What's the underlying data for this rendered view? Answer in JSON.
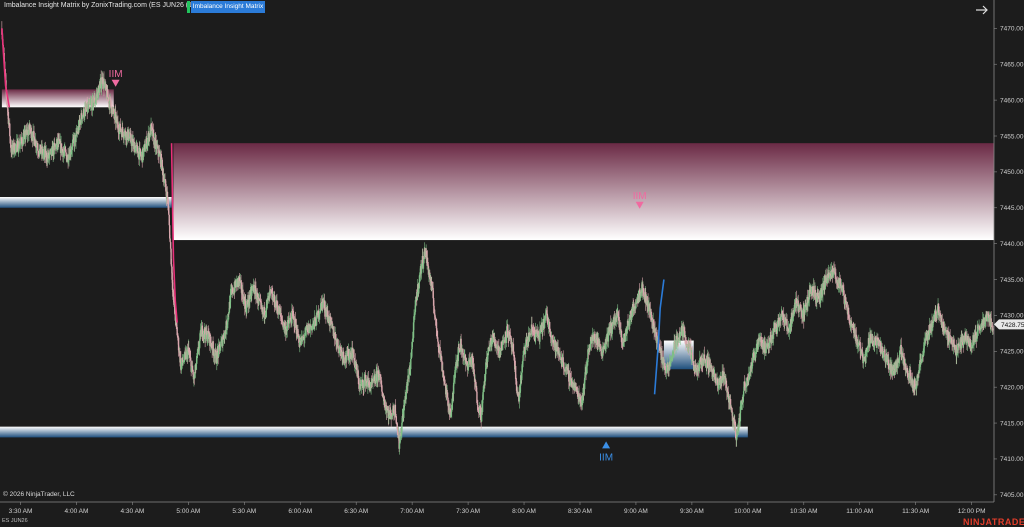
{
  "header": {
    "title": "Imbalance Insight Matrix by ZonixTrading.com (ES JUN26 (1 Minute))",
    "indicator_tab": "Imbalance Insight Matrix"
  },
  "footer": {
    "copyright": "© 2026 NinjaTrader, LLC",
    "instrument": "ES JUN26",
    "brand": "NINJATRADER"
  },
  "icons": {
    "nav": "arrow-right-icon"
  },
  "colors": {
    "background": "#1c1c1c",
    "bull_candle": "#7fbf86",
    "bear_candle": "#d9a7ad",
    "bear_zone": "#6b2a45",
    "bull_zone": "#1f4f7d",
    "iim_bear": "#f06aa0",
    "iim_bull": "#3b8fe6",
    "trend_down": "#e8317a",
    "trend_up": "#2b7bd8",
    "price_marker": "#e8e8e8"
  },
  "chart_data": {
    "type": "candlestick",
    "instrument": "ES JUN26",
    "interval": "1 Minute",
    "ylim": [
      7404,
      7472
    ],
    "y_ticks": [
      7405,
      7410,
      7415,
      7420,
      7425,
      7430,
      7435,
      7440,
      7445,
      7450,
      7455,
      7460,
      7465,
      7470
    ],
    "y_tick_labels": [
      "7405.00",
      "7410.00",
      "7415.00",
      "7420.00",
      "7425.00",
      "7430.00",
      "7435.00",
      "7440.00",
      "7445.00",
      "7450.00",
      "7455.00",
      "7460.00",
      "7465.00",
      "7470.00"
    ],
    "x_ticks": [
      {
        "label": "3:30 AM",
        "t": 210
      },
      {
        "label": "4:00 AM",
        "t": 240
      },
      {
        "label": "4:30 AM",
        "t": 270
      },
      {
        "label": "5:00 AM",
        "t": 300
      },
      {
        "label": "5:30 AM",
        "t": 330
      },
      {
        "label": "6:00 AM",
        "t": 360
      },
      {
        "label": "6:30 AM",
        "t": 390
      },
      {
        "label": "7:00 AM",
        "t": 420
      },
      {
        "label": "7:30 AM",
        "t": 450
      },
      {
        "label": "8:00 AM",
        "t": 480
      },
      {
        "label": "8:30 AM",
        "t": 510
      },
      {
        "label": "9:00 AM",
        "t": 540
      },
      {
        "label": "9:30 AM",
        "t": 570
      },
      {
        "label": "10:00 AM",
        "t": 600
      },
      {
        "label": "10:30 AM",
        "t": 630
      },
      {
        "label": "11:00 AM",
        "t": 660
      },
      {
        "label": "11:30 AM",
        "t": 690
      },
      {
        "label": "12:00 PM",
        "t": 720
      }
    ],
    "time_range": [
      199,
      732
    ],
    "last_price": "7428.75",
    "last_value": 7428.75,
    "price_path": [
      [
        200,
        7470
      ],
      [
        202,
        7462
      ],
      [
        205,
        7453
      ],
      [
        210,
        7454
      ],
      [
        215,
        7456
      ],
      [
        220,
        7453
      ],
      [
        225,
        7452
      ],
      [
        230,
        7454
      ],
      [
        235,
        7452
      ],
      [
        240,
        7455
      ],
      [
        243,
        7458
      ],
      [
        247,
        7459
      ],
      [
        250,
        7460
      ],
      [
        254,
        7463
      ],
      [
        256,
        7461
      ],
      [
        260,
        7458
      ],
      [
        263,
        7456
      ],
      [
        268,
        7455
      ],
      [
        270,
        7454
      ],
      [
        275,
        7452
      ],
      [
        280,
        7456
      ],
      [
        282,
        7454
      ],
      [
        285,
        7452
      ],
      [
        289,
        7446
      ],
      [
        292,
        7432
      ],
      [
        296,
        7423
      ],
      [
        300,
        7425
      ],
      [
        303,
        7421
      ],
      [
        307,
        7428
      ],
      [
        311,
        7427
      ],
      [
        315,
        7424
      ],
      [
        320,
        7428
      ],
      [
        323,
        7433
      ],
      [
        327,
        7435
      ],
      [
        331,
        7431
      ],
      [
        335,
        7434
      ],
      [
        340,
        7430
      ],
      [
        344,
        7433
      ],
      [
        348,
        7431
      ],
      [
        352,
        7428
      ],
      [
        356,
        7430
      ],
      [
        360,
        7426
      ],
      [
        364,
        7428
      ],
      [
        368,
        7429
      ],
      [
        372,
        7432
      ],
      [
        376,
        7429
      ],
      [
        380,
        7426
      ],
      [
        384,
        7424
      ],
      [
        388,
        7425
      ],
      [
        392,
        7420
      ],
      [
        395,
        7421
      ],
      [
        398,
        7420
      ],
      [
        402,
        7422
      ],
      [
        405,
        7418
      ],
      [
        408,
        7416
      ],
      [
        411,
        7417
      ],
      [
        413,
        7412
      ],
      [
        416,
        7418
      ],
      [
        419,
        7423
      ],
      [
        422,
        7432
      ],
      [
        425,
        7437
      ],
      [
        427,
        7439
      ],
      [
        429,
        7436
      ],
      [
        431,
        7433
      ],
      [
        433,
        7428
      ],
      [
        436,
        7423
      ],
      [
        439,
        7418
      ],
      [
        441,
        7416
      ],
      [
        443,
        7423
      ],
      [
        446,
        7426
      ],
      [
        449,
        7423
      ],
      [
        452,
        7424
      ],
      [
        455,
        7418
      ],
      [
        457,
        7416
      ],
      [
        460,
        7424
      ],
      [
        463,
        7427
      ],
      [
        467,
        7425
      ],
      [
        471,
        7428
      ],
      [
        474,
        7425
      ],
      [
        477,
        7418
      ],
      [
        480,
        7425
      ],
      [
        484,
        7428
      ],
      [
        488,
        7427
      ],
      [
        492,
        7430
      ],
      [
        496,
        7426
      ],
      [
        500,
        7424
      ],
      [
        503,
        7422
      ],
      [
        507,
        7420
      ],
      [
        511,
        7418
      ],
      [
        515,
        7426
      ],
      [
        518,
        7427
      ],
      [
        522,
        7425
      ],
      [
        526,
        7428
      ],
      [
        530,
        7430
      ],
      [
        533,
        7426
      ],
      [
        536,
        7429
      ],
      [
        540,
        7432
      ],
      [
        543,
        7434
      ],
      [
        547,
        7431
      ],
      [
        550,
        7428
      ],
      [
        554,
        7424
      ],
      [
        557,
        7422
      ],
      [
        561,
        7426
      ],
      [
        565,
        7428
      ],
      [
        569,
        7425
      ],
      [
        572,
        7422
      ],
      [
        576,
        7424
      ],
      [
        580,
        7423
      ],
      [
        584,
        7420
      ],
      [
        587,
        7422
      ],
      [
        591,
        7417
      ],
      [
        594,
        7413
      ],
      [
        598,
        7420
      ],
      [
        602,
        7423
      ],
      [
        606,
        7427
      ],
      [
        610,
        7425
      ],
      [
        614,
        7428
      ],
      [
        618,
        7430
      ],
      [
        622,
        7428
      ],
      [
        626,
        7432
      ],
      [
        630,
        7430
      ],
      [
        634,
        7434
      ],
      [
        638,
        7432
      ],
      [
        642,
        7435
      ],
      [
        646,
        7436
      ],
      [
        650,
        7434
      ],
      [
        654,
        7430
      ],
      [
        658,
        7427
      ],
      [
        662,
        7424
      ],
      [
        666,
        7427
      ],
      [
        670,
        7426
      ],
      [
        674,
        7424
      ],
      [
        678,
        7422
      ],
      [
        682,
        7425
      ],
      [
        686,
        7422
      ],
      [
        690,
        7420
      ],
      [
        693,
        7424
      ],
      [
        696,
        7427
      ],
      [
        699,
        7429
      ],
      [
        702,
        7431
      ],
      [
        705,
        7428
      ],
      [
        708,
        7427
      ],
      [
        712,
        7425
      ],
      [
        716,
        7427
      ],
      [
        720,
        7426
      ],
      [
        724,
        7428
      ],
      [
        728,
        7430
      ],
      [
        731,
        7428.75
      ]
    ],
    "zones": [
      {
        "kind": "bearish",
        "from_t": 200,
        "to_t": 260,
        "top": 7461.5,
        "bottom": 7459
      },
      {
        "kind": "bearish",
        "from_t": 292,
        "to_t": 732,
        "top": 7454,
        "bottom": 7440.5
      },
      {
        "kind": "bullish",
        "from_t": 199,
        "to_t": 291,
        "top": 7446.5,
        "bottom": 7445
      },
      {
        "kind": "bullish",
        "from_t": 199,
        "to_t": 600,
        "top": 7414.5,
        "bottom": 7413
      },
      {
        "kind": "bullish",
        "from_t": 555,
        "to_t": 571,
        "top": 7426.5,
        "bottom": 7422.5
      }
    ],
    "markers": [
      {
        "label": "IIM",
        "t": 261,
        "y": 7462,
        "dir": "down",
        "kind": "bearish"
      },
      {
        "label": "IIM",
        "t": 542,
        "y": 7445,
        "dir": "down",
        "kind": "bearish"
      },
      {
        "label": "IIM",
        "t": 524,
        "y": 7413,
        "dir": "up",
        "kind": "bullish"
      }
    ],
    "trend_segments": [
      {
        "kind": "bearish",
        "path": [
          [
            200,
            7470
          ],
          [
            202,
            7462
          ],
          [
            204,
            7459
          ]
        ]
      },
      {
        "kind": "bearish",
        "path": [
          [
            291,
            7454
          ],
          [
            292,
            7438
          ],
          [
            293,
            7432
          ],
          [
            294,
            7429
          ]
        ]
      },
      {
        "kind": "bullish",
        "path": [
          [
            550,
            7419
          ],
          [
            552,
            7426
          ],
          [
            553,
            7431
          ],
          [
            555,
            7435
          ]
        ]
      }
    ]
  }
}
